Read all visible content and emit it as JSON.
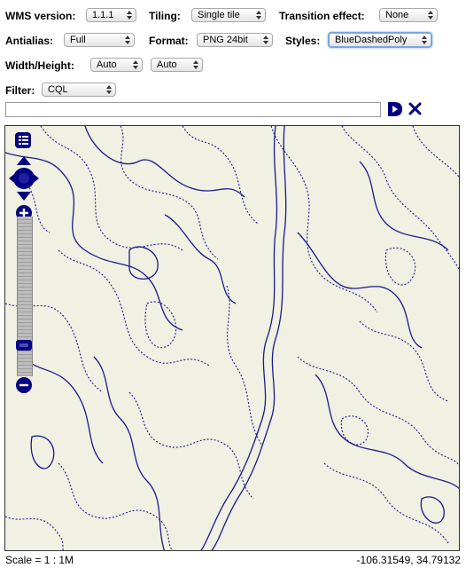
{
  "controls": {
    "wms_version": {
      "label": "WMS version:",
      "value": "1.1.1"
    },
    "tiling": {
      "label": "Tiling:",
      "value": "Single tile"
    },
    "transition": {
      "label": "Transition effect:",
      "value": "None"
    },
    "antialias": {
      "label": "Antialias:",
      "value": "Full"
    },
    "format": {
      "label": "Format:",
      "value": "PNG 24bit"
    },
    "styles": {
      "label": "Styles:",
      "value": "BlueDashedPoly"
    },
    "width_height": {
      "label": "Width/Height:",
      "width": "Auto",
      "height": "Auto"
    },
    "filter": {
      "label": "Filter:",
      "value": "CQL",
      "text": ""
    }
  },
  "icons": {
    "apply": "play-icon",
    "reset": "close-icon",
    "layer_switcher": "layers-icon",
    "pan": "pan-arrows-icon",
    "zoom_in": "plus-icon",
    "zoom_out": "minus-icon"
  },
  "colors": {
    "map_background": "#f0f0e3",
    "feature_stroke": "#1a1a8c",
    "control_blue": "#000080"
  },
  "footer": {
    "scale": "Scale = 1 : 1M",
    "coordinates": "-106.31549, 34.79132"
  }
}
